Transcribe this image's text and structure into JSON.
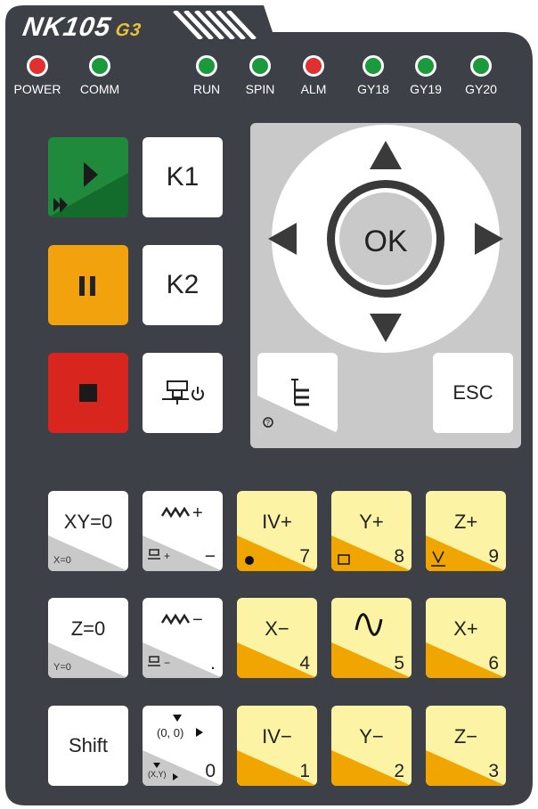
{
  "brand": {
    "model": "NK105",
    "gen": "G3"
  },
  "leds": [
    {
      "label": "POWER",
      "color": "#e03030"
    },
    {
      "label": "COMM",
      "color": "#1a9a3a"
    },
    {
      "label": "RUN",
      "color": "#1a9a3a"
    },
    {
      "label": "SPIN",
      "color": "#1a9a3a"
    },
    {
      "label": "ALM",
      "color": "#e03030"
    },
    {
      "label": "GY18",
      "color": "#1a9a3a"
    },
    {
      "label": "GY19",
      "color": "#1a9a3a"
    },
    {
      "label": "GY20",
      "color": "#1a9a3a"
    }
  ],
  "colors": {
    "start": "#1f8a3c",
    "pause": "#f2a20c",
    "stop": "#d8261e",
    "yellow": "#fdf3a5",
    "orange": "#f0a500"
  },
  "keys": {
    "start": {
      "icon": "play-icon"
    },
    "pause": {
      "icon": "pause-icon"
    },
    "stop": {
      "icon": "stop-icon"
    },
    "k1": {
      "label": "K1"
    },
    "k2": {
      "label": "K2"
    },
    "spindle": {
      "icon": "spindle-power-icon"
    },
    "ok": {
      "label": "OK"
    },
    "menu": {
      "icon": "menu-tree-icon",
      "sub_icon": "help-icon"
    },
    "esc": {
      "label": "ESC"
    },
    "xy0": {
      "label": "XY=0",
      "sub": "X=0"
    },
    "feed_plus": {
      "label": "+",
      "num": "−",
      "sub": "+"
    },
    "iv_plus": {
      "label": "IV+",
      "num": "7"
    },
    "y_plus": {
      "label": "Y+",
      "num": "8"
    },
    "z_plus": {
      "label": "Z+",
      "num": "9"
    },
    "z0": {
      "label": "Z=0",
      "sub": "Y=0"
    },
    "feed_minus": {
      "label": "−",
      "num": ".",
      "sub": "−"
    },
    "x_minus": {
      "label": "X−",
      "num": "4"
    },
    "step": {
      "icon": "wave-icon",
      "num": "5"
    },
    "x_plus": {
      "label": "X+",
      "num": "6"
    },
    "shift": {
      "label": "Shift"
    },
    "origin": {
      "label": "(0, 0)",
      "sub": "(X,Y)",
      "num": "0"
    },
    "iv_minus": {
      "label": "IV−",
      "num": "1"
    },
    "y_minus": {
      "label": "Y−",
      "num": "2"
    },
    "z_minus": {
      "label": "Z−",
      "num": "3"
    }
  }
}
